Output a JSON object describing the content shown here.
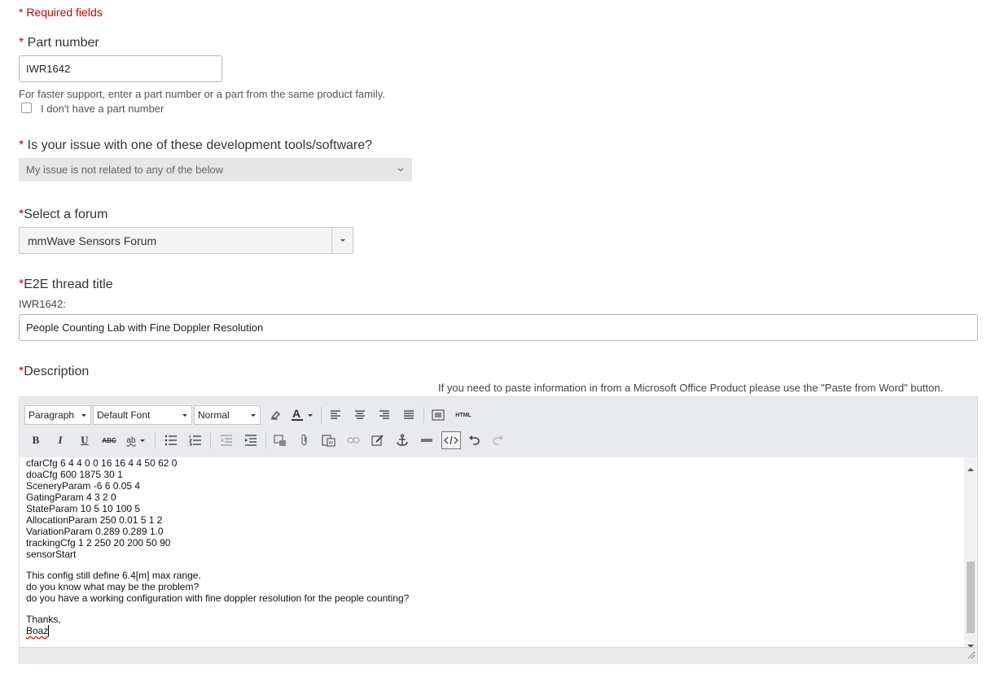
{
  "required_note": {
    "star": "*",
    "text": " Required fields"
  },
  "part_number": {
    "star": "*",
    "label": " Part number",
    "value": "IWR1642",
    "help": "For faster support, enter a part number or a part from the same product family.",
    "checkbox_label": "I don't have a part number"
  },
  "dev_tools": {
    "star": "*",
    "label": " Is your issue with one of these development tools/software?",
    "selected": "My issue is not related to any of the below"
  },
  "forum": {
    "star": "*",
    "label": "Select a forum",
    "selected": "mmWave Sensors Forum"
  },
  "thread_title": {
    "star": "*",
    "label": "E2E thread title",
    "prefix": "IWR1642:",
    "value": "People Counting Lab with Fine Doppler Resolution"
  },
  "description": {
    "star": "*",
    "label": "Description",
    "paste_note": "If you need to paste information in from a Microsoft Office Product please use the \"Paste from Word\" button."
  },
  "editor": {
    "toolbar": {
      "format": "Paragraph",
      "font": "Default Font",
      "size": "Normal",
      "html_label": "HTML",
      "bold": "B",
      "italic": "I",
      "underline": "U",
      "strike": "ABC",
      "spell": "ab"
    },
    "lines_config": [
      "cfarCfg 6 4 4 0 0 16 16 4 4 50 62 0",
      "doaCfg 600 1875 30 1",
      "SceneryParam -6 6 0.05 4",
      "GatingParam 4 3 2 0",
      "StateParam 10 5 10 100 5",
      "AllocationParam 250 0.01 5 1 2",
      "VariationParam 0.289 0.289 1.0",
      "trackingCfg 1 2 250 20 200 50 90",
      "sensorStart"
    ],
    "lines_message": [
      "This config still define 6.4[m] max range.",
      "do you know what may be the problem?",
      "do you have a working configuration with fine doppler resolution for the people counting?"
    ],
    "thanks": "Thanks,",
    "signature": "Boaz"
  },
  "colors": {
    "required": "#cc0000",
    "editor_bg": "#e8eaed"
  }
}
